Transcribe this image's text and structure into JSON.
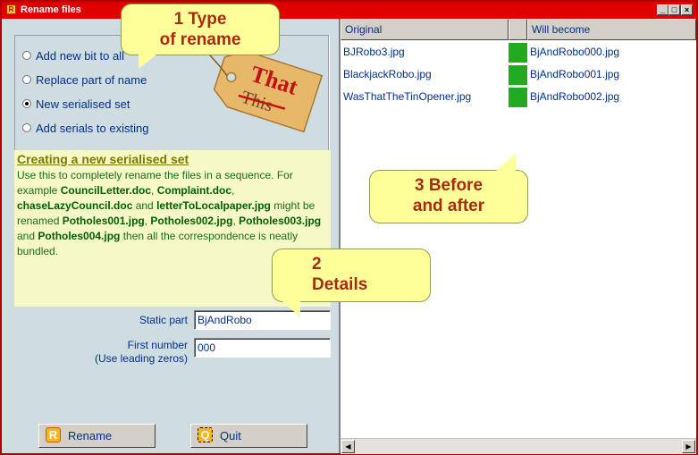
{
  "window": {
    "title": "Rename files"
  },
  "rename_types": [
    {
      "label": "Add new bit to all",
      "selected": false
    },
    {
      "label": "Replace part of name",
      "selected": false
    },
    {
      "label": "New serialised set",
      "selected": true
    },
    {
      "label": "Add serials to existing",
      "selected": false
    }
  ],
  "tag_image": {
    "word_that": "That",
    "word_this": "This"
  },
  "info": {
    "title": "Creating a new serialised set",
    "t1": "Use this to completely rename the files in a sequence. For example ",
    "f1": "CouncilLetter.doc",
    "s1": ", ",
    "f2": "Complaint.doc",
    "s2": ", ",
    "f3": "chaseLazyCouncil.doc",
    "s3": " and ",
    "f4": "letterToLocalpaper.jpg",
    "s4": " might be renamed ",
    "f5": "Potholes001.jpg",
    "s5": ", ",
    "f6": "Potholes002.jpg",
    "s6": ", ",
    "f7": "Potholes003.jpg",
    "s7": " and ",
    "f8": "Potholes004.jpg",
    "s8": " then all the correspondence is neatly bundled."
  },
  "fields": {
    "static_label": "Static part",
    "static_value": "BjAndRobo",
    "first_label": "First number",
    "first_hint": "(Use leading zeros)",
    "first_value": "000"
  },
  "buttons": {
    "rename": "Rename",
    "rename_icon": "R",
    "quit": "Quit",
    "quit_icon": "Q"
  },
  "list": {
    "col_original": "Original",
    "col_become": "Will become",
    "rows": [
      {
        "original": "BJRobo3.jpg",
        "become": "BjAndRobo000.jpg"
      },
      {
        "original": "BlackjackRobo.jpg",
        "become": "BjAndRobo001.jpg"
      },
      {
        "original": "WasThatTheTinOpener.jpg",
        "become": "BjAndRobo002.jpg"
      }
    ]
  },
  "callouts": {
    "c1_l1": "1 Type",
    "c1_l2": "of rename",
    "c2_l1": "2",
    "c2_l2": "Details",
    "c3_l1": "3 Before",
    "c3_l2": "and after"
  },
  "colors": {
    "titlebar": "#e00000",
    "status_swatch": "#22aa22",
    "callout_fill": "#ffff99",
    "callout_text": "#a82a10"
  }
}
